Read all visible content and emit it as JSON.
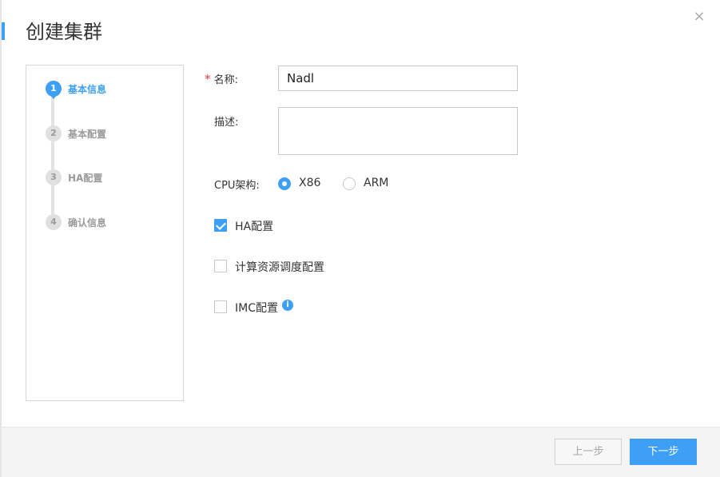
{
  "dialog": {
    "title": "创建集群",
    "close_icon": "×"
  },
  "steps": [
    {
      "number": "1",
      "label": "基本信息",
      "active": true
    },
    {
      "number": "2",
      "label": "基本配置",
      "active": false
    },
    {
      "number": "3",
      "label": "HA配置",
      "active": false
    },
    {
      "number": "4",
      "label": "确认信息",
      "active": false
    }
  ],
  "form": {
    "name": {
      "required_mark": "*",
      "label": "名称:",
      "value": "Nadl"
    },
    "description": {
      "label": "描述:",
      "value": ""
    },
    "cpu_arch": {
      "label": "CPU架构:",
      "options": [
        {
          "label": "X86",
          "checked": true
        },
        {
          "label": "ARM",
          "checked": false
        }
      ]
    },
    "ha_config": {
      "label": "HA配置",
      "checked": true
    },
    "compute_scheduling": {
      "label": "计算资源调度配置",
      "checked": false
    },
    "imc_config": {
      "label": "IMC配置",
      "checked": false,
      "info_icon": "i"
    }
  },
  "footer": {
    "prev_label": "上一步",
    "next_label": "下一步"
  },
  "colors": {
    "accent": "#3d9ff5",
    "required": "#e83a3a"
  }
}
